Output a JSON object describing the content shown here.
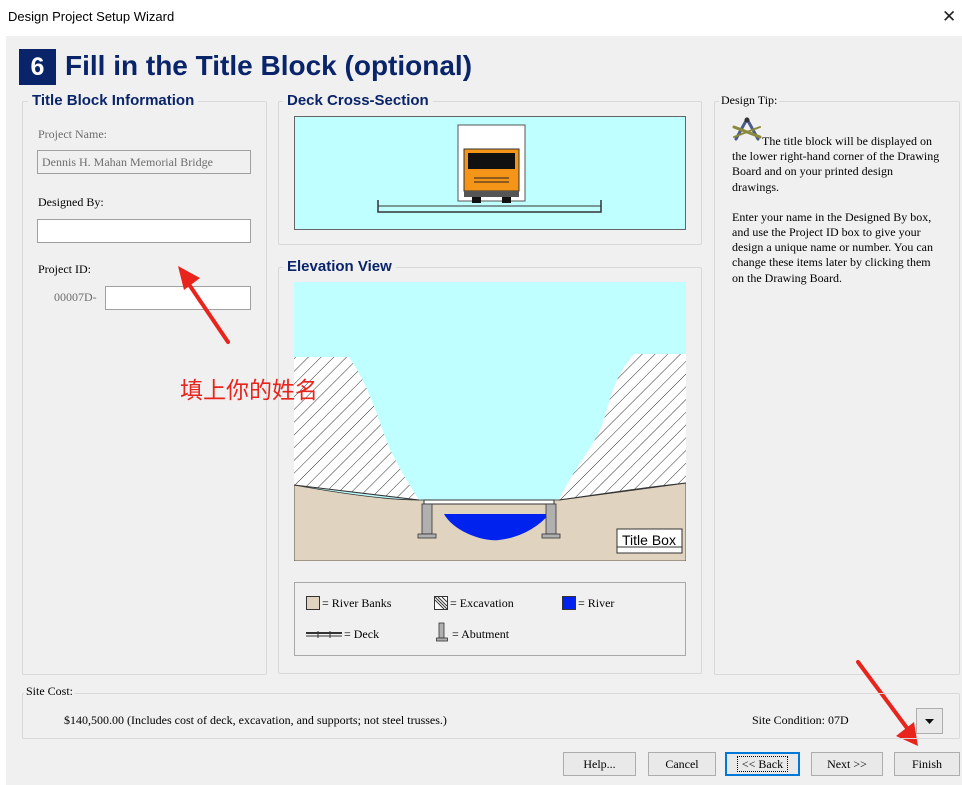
{
  "window": {
    "title": "Design Project Setup Wizard",
    "close_glyph": "✕"
  },
  "step": {
    "number": "6",
    "title": "Fill in the Title Block (optional)"
  },
  "title_block": {
    "heading": "Title Block Information",
    "project_name_label": "Project Name:",
    "project_name_value": "Dennis H. Mahan Memorial Bridge",
    "designed_by_label": "Designed By:",
    "designed_by_value": "",
    "project_id_label": "Project ID:",
    "project_id_prefix": "00007D-",
    "project_id_value": ""
  },
  "deck": {
    "heading": "Deck Cross-Section"
  },
  "elevation": {
    "heading": "Elevation View",
    "title_box_label": "Title Box"
  },
  "legend": {
    "river_banks": "= River Banks",
    "excavation": "= Excavation",
    "river": "= River",
    "deck": "= Deck",
    "abutment": "= Abutment"
  },
  "tip": {
    "heading": "Design Tip:",
    "icon": "drafting-compass-icon",
    "paragraph1": "The title block will be displayed on the lower right-hand corner of the Drawing Board and on your printed design drawings.",
    "paragraph2": "Enter your name in the Designed By box, and use the Project ID box to give your design a unique name or number. You can change these items later by clicking them on the Drawing Board."
  },
  "annotation": {
    "text": "填上你的姓名",
    "color": "#e8241c"
  },
  "site": {
    "cost_label": "Site Cost:",
    "cost_text": "$140,500.00  (Includes cost of deck, excavation, and supports; not steel trusses.)",
    "condition_label": "Site Condition: 07D"
  },
  "buttons": {
    "help": "Help...",
    "cancel": "Cancel",
    "back": "<< Back",
    "next": "Next >>",
    "finish": "Finish"
  },
  "colors": {
    "accent": "#0a246a",
    "sky": "#c0ffff",
    "banks": "#e0d3bf",
    "river": "#0022ee",
    "arrow": "#e8241c"
  }
}
